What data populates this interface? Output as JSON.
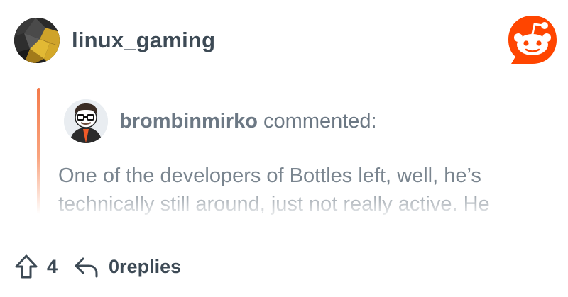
{
  "subreddit": {
    "name": "linux_gaming",
    "avatar_icon": "penguin-avatar-icon"
  },
  "brand": {
    "logo_icon": "reddit-logo-icon",
    "accent_color": "#ff4500"
  },
  "comment": {
    "author": "brombinmirko",
    "action_text": "commented:",
    "body": "One of the developers of Bottles left, well, he’s technically still around, just not really active. He",
    "author_avatar_icon": "snoo-avatar-icon"
  },
  "footer": {
    "upvote_icon": "upvote-arrow-icon",
    "upvotes": "4",
    "reply_icon": "reply-arrow-icon",
    "replies": "0replies"
  }
}
